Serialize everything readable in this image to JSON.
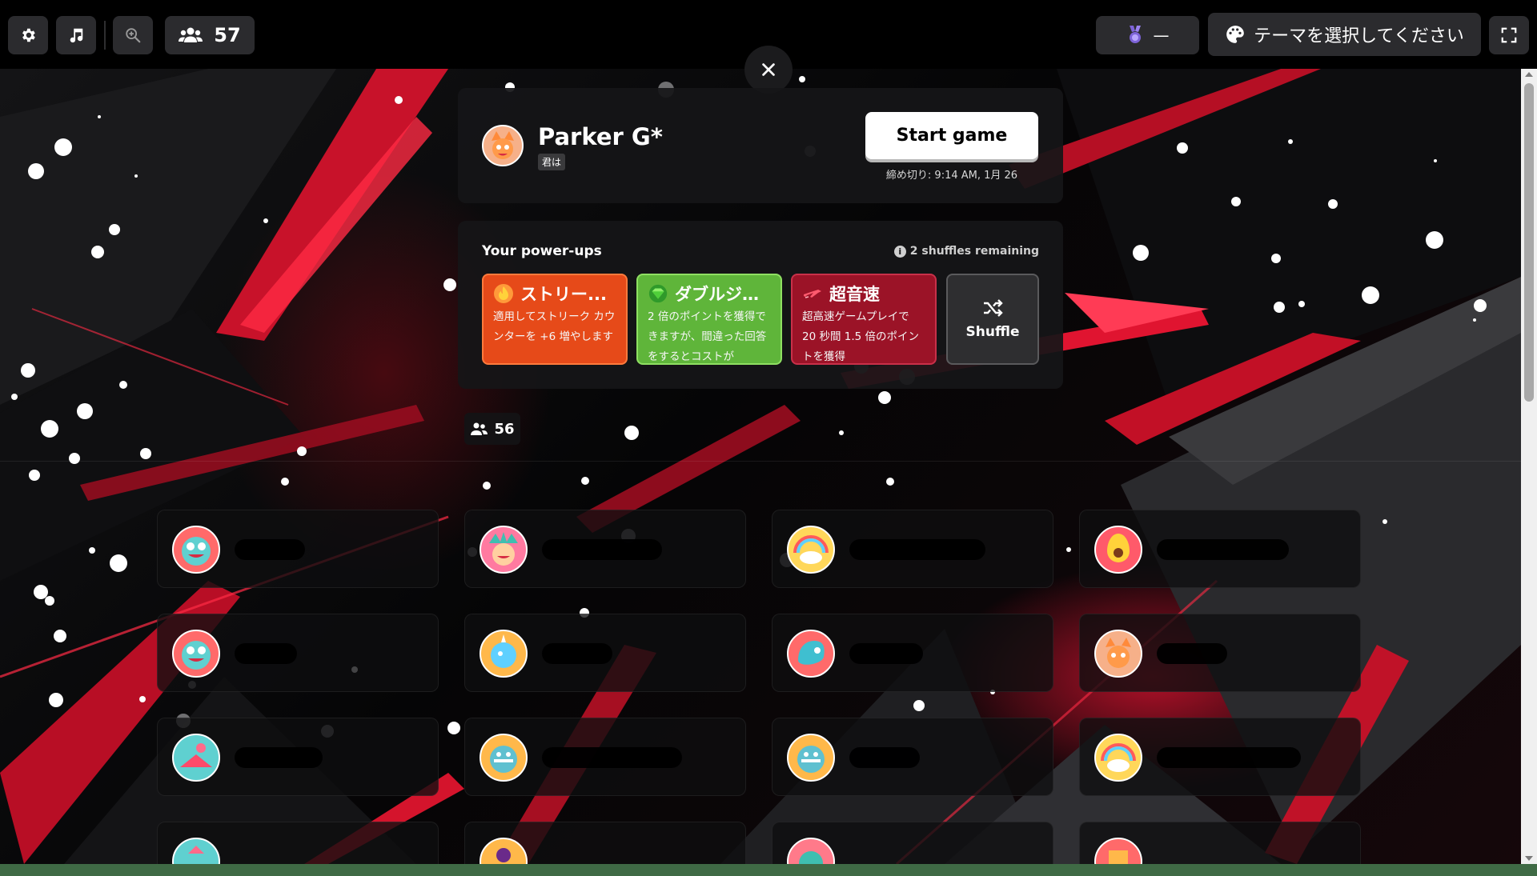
{
  "topbar": {
    "settings_icon": "gear-icon",
    "music_icon": "music-note-icon",
    "zoom_icon": "zoom-in-icon",
    "players_icon": "users-icon",
    "player_count": "57",
    "medal_icon": "medal-icon",
    "medal_value": "—",
    "theme_icon": "palette-icon",
    "theme_label": "テーマを選択してください",
    "fullscreen_icon": "fullscreen-icon"
  },
  "close_icon": "close-icon",
  "host": {
    "name": "Parker G*",
    "tag": "君は",
    "start_label": "Start game",
    "deadline": "締め切り: 9:14 AM, 1月 26"
  },
  "powerups": {
    "title": "Your power-ups",
    "shuffles_remaining": "2 shuffles remaining",
    "items": [
      {
        "name": "ストリー...",
        "description": "適用してストリーク カウンターを +6 増やします",
        "icon": "flame-icon",
        "color": "#e64a19"
      },
      {
        "name": "ダブルジェ...",
        "description": "2 倍のポイントを獲得できますが、間違った回答をするとコストが",
        "icon": "double-gem-icon",
        "color": "#5fb53a"
      },
      {
        "name": "超音速",
        "description": "超高速ゲームプレイで 20 秒間 1.5 倍のポイントを獲得",
        "icon": "jet-icon",
        "color": "#9b1327"
      }
    ],
    "shuffle_label": "Shuffle",
    "shuffle_icon": "shuffle-icon"
  },
  "lobby": {
    "player_count": "56",
    "players_icon": "users-icon"
  },
  "colors": {
    "accent_red": "#e01430",
    "button_dark": "#2b2b2e",
    "streak": "#e64a19",
    "double_jeopardy": "#5fb53a",
    "supersonic": "#9b1327"
  }
}
